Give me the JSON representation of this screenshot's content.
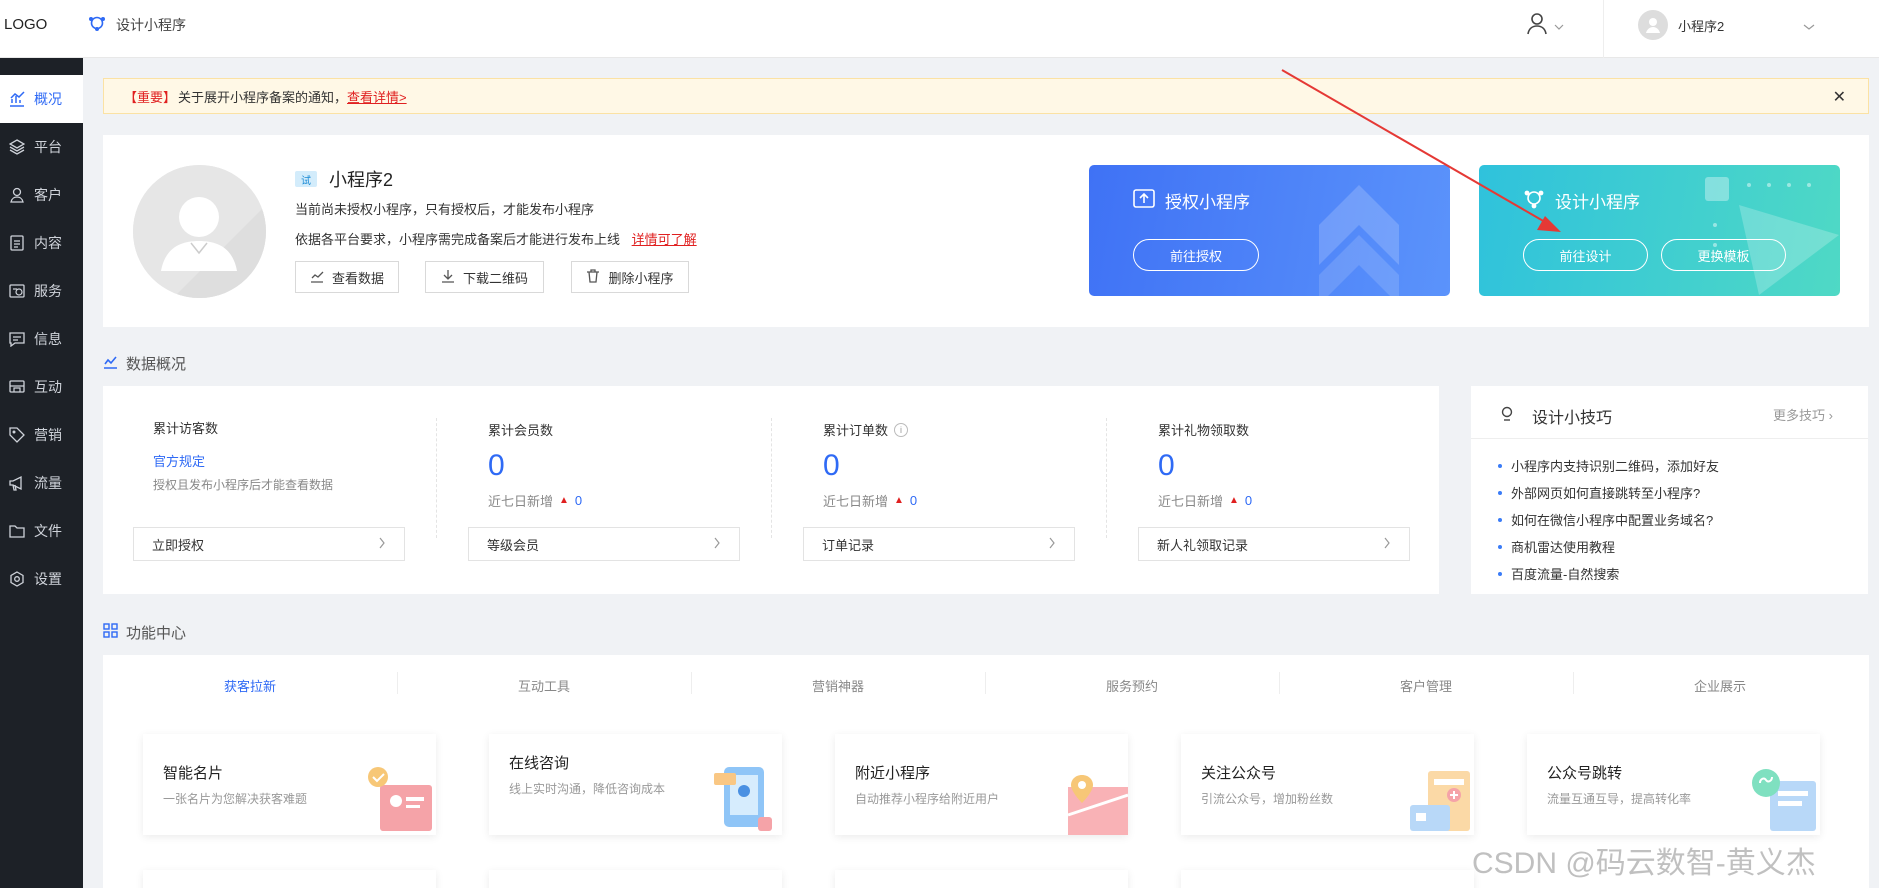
{
  "header": {
    "logo": "LOGO",
    "design_link": "设计小程序",
    "account_name": "小程序2"
  },
  "sidebar": {
    "items": [
      {
        "label": "概况",
        "icon": "chart-icon",
        "active": true
      },
      {
        "label": "平台",
        "icon": "layers-icon",
        "active": false
      },
      {
        "label": "客户",
        "icon": "user-icon",
        "active": false
      },
      {
        "label": "内容",
        "icon": "document-icon",
        "active": false
      },
      {
        "label": "服务",
        "icon": "service-icon",
        "active": false
      },
      {
        "label": "信息",
        "icon": "message-icon",
        "active": false
      },
      {
        "label": "互动",
        "icon": "interact-icon",
        "active": false
      },
      {
        "label": "营销",
        "icon": "tag-icon",
        "active": false
      },
      {
        "label": "流量",
        "icon": "megaphone-icon",
        "active": false
      },
      {
        "label": "文件",
        "icon": "folder-icon",
        "active": false
      },
      {
        "label": "设置",
        "icon": "settings-icon",
        "active": false
      }
    ]
  },
  "notice": {
    "important": "【重要】",
    "text": "关于展开小程序备案的通知，",
    "link": "查看详情>"
  },
  "app": {
    "tag": "试",
    "name": "小程序2",
    "line1": "当前尚未授权小程序，只有授权后，才能发布小程序",
    "line2": "依据各平台要求，小程序需完成备案后才能进行发布上线",
    "line2_link": "详情可了解",
    "btn_data": "查看数据",
    "btn_qrcode": "下载二维码",
    "btn_delete": "删除小程序"
  },
  "banners": {
    "auth_title": "授权小程序",
    "auth_button": "前往授权",
    "design_title": "设计小程序",
    "design_button": "前往设计",
    "template_button": "更换模板",
    "auth_color": "#3d78f5",
    "design_color": "#37c9d8"
  },
  "overview": {
    "title": "数据概况",
    "stats": [
      {
        "label": "累计访客数",
        "rule": "官方规定",
        "note": "授权且发布小程序后才能查看数据",
        "link": "立即授权"
      },
      {
        "label": "累计会员数",
        "value": "0",
        "sub": "近七日新增",
        "delta": "0",
        "link": "等级会员"
      },
      {
        "label": "累计订单数",
        "value": "0",
        "sub": "近七日新增",
        "delta": "0",
        "link": "订单记录"
      },
      {
        "label": "累计礼物领取数",
        "value": "0",
        "sub": "近七日新增",
        "delta": "0",
        "link": "新人礼领取记录"
      }
    ]
  },
  "tips": {
    "title": "设计小技巧",
    "more": "更多技巧",
    "items": [
      "小程序内支持识别二维码，添加好友",
      "外部网页如何直接跳转至小程序?",
      "如何在微信小程序中配置业务域名?",
      "商机雷达使用教程",
      "百度流量-自然搜索"
    ]
  },
  "functions": {
    "title": "功能中心",
    "tabs": [
      "获客拉新",
      "互动工具",
      "营销神器",
      "服务预约",
      "客户管理",
      "企业展示"
    ],
    "cards": [
      {
        "title": "智能名片",
        "desc": "一张名片为您解决获客难题"
      },
      {
        "title": "在线咨询",
        "desc": "线上实时沟通，降低咨询成本"
      },
      {
        "title": "附近小程序",
        "desc": "自动推荐小程序给附近用户"
      },
      {
        "title": "关注公众号",
        "desc": "引流公众号，增加粉丝数"
      },
      {
        "title": "公众号跳转",
        "desc": "流量互通互导，提高转化率"
      }
    ]
  },
  "watermark": "CSDN @码云数智-黄义杰"
}
